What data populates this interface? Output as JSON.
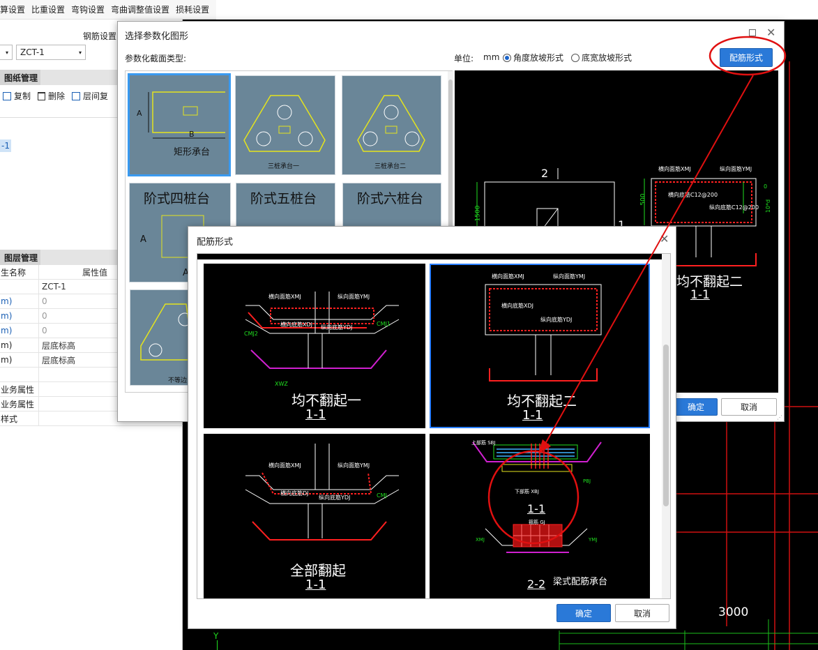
{
  "top_menu": {
    "items": [
      "算设置",
      "比重设置",
      "弯钩设置",
      "弯曲调整值设置",
      "损耗设置"
    ]
  },
  "left_panel": {
    "steel_settings_label": "钢筋设置",
    "select_prefix": "",
    "select_value": "ZCT-1",
    "drawing_tab": "图纸管理",
    "toolbar": {
      "copy": "复制",
      "delete": "删除",
      "floor_copy": "层间复"
    },
    "tree_item": "-1",
    "layer_tab": "图层管理",
    "props_header": {
      "name": "生名称",
      "value": "属性值"
    },
    "props": [
      {
        "name": "",
        "value": "ZCT-1",
        "nameBlack": true
      },
      {
        "name": "m)",
        "value": "0",
        "valueGray": true
      },
      {
        "name": "m)",
        "value": "0",
        "valueGray": true
      },
      {
        "name": "m)",
        "value": "0",
        "valueGray": true
      },
      {
        "name": "m)",
        "value": "层底标高",
        "nameBlack": true
      },
      {
        "name": "m)",
        "value": "层底标高",
        "nameBlack": true
      },
      {
        "name": "",
        "value": ""
      },
      {
        "name": "业务属性",
        "value": "",
        "nameBlack": true
      },
      {
        "name": "业务属性",
        "value": "",
        "nameBlack": true
      },
      {
        "name": "样式",
        "value": "",
        "nameBlack": true
      }
    ]
  },
  "main_dialog": {
    "title": "选择参数化图形",
    "section_type_label": "参数化截面类型:",
    "unit_label": "单位:",
    "unit_value": "mm",
    "radio_angle": "角度放坡形式",
    "radio_width": "底宽放坡形式",
    "rebar_form_button": "配筋形式",
    "ok": "确定",
    "cancel": "取消",
    "thumbnails": [
      {
        "label": "矩形承台"
      },
      {
        "label": "三桩承台一"
      },
      {
        "label": "三桩承台二"
      },
      {
        "label": "阶式四桩台"
      },
      {
        "label": "阶式五桩台"
      },
      {
        "label": "阶式六桩台"
      },
      {
        "label": "不等边"
      }
    ],
    "preview": {
      "section_num": "2",
      "section_mark": "1",
      "dim_left": "1500",
      "dim_right_500": "500",
      "caption": "均不翻起二",
      "caption_sub": "1-1",
      "labels": {
        "hx": "横向面筋XMJ",
        "zx": "纵向面筋YMJ",
        "hd": "横向底筋C12@200",
        "zd": "纵向底筋C12@200",
        "d10": "10*d",
        "zero": "0"
      },
      "bottom_dim": "3000"
    }
  },
  "sub_dialog": {
    "title": "配筋形式",
    "ok": "确定",
    "cancel": "取消",
    "panels": [
      {
        "title": "均不翻起一",
        "sub": "1-1"
      },
      {
        "title": "均不翻起二",
        "sub": "1-1"
      },
      {
        "title": "全部翻起",
        "sub": "1-1"
      },
      {
        "title": "梁式配筋承台",
        "sub": "1-1",
        "sub2": "2-2"
      }
    ],
    "labels": {
      "hxmj": "横向面筋XMJ",
      "zxmj": "纵向面筋YMJ",
      "hxdj": "横向底筋XDJ",
      "zxdj": "纵向底筋YDJ",
      "hxdj2": "横向底筋DJ",
      "cmj": "CMJ",
      "cmj1": "CMJ1",
      "cmj2": "CMJ2",
      "xwz": "XWZ",
      "sbj": "上部筋 SBJ",
      "xbj": "下部筋 XBJ",
      "pbj": "PBJ",
      "gj": "箍筋 GJ",
      "ymj": "YMJ",
      "xmj": "XMJ"
    }
  },
  "axis": {
    "y": "Y"
  },
  "colors": {
    "accent": "#2a79d8",
    "annotation_red": "#e01010",
    "cad_red": "#ff2020",
    "cad_green": "#20e020",
    "thumb_bg": "#6a8698"
  }
}
